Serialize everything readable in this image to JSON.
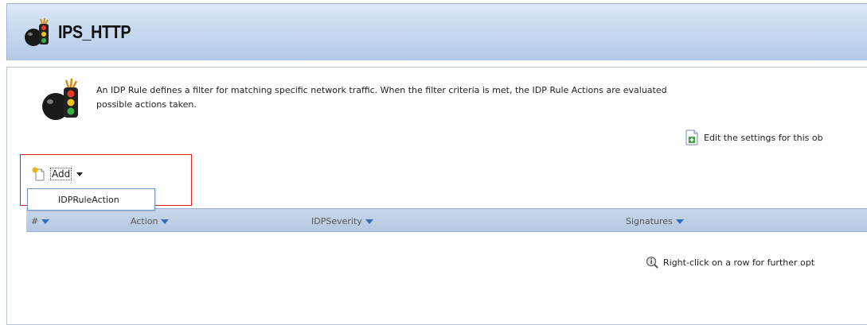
{
  "header": {
    "title": "IPS_HTTP",
    "logo_icon": "traffic-light-bomb-icon"
  },
  "description": {
    "line1": "An IDP Rule defines a filter for matching specific network traffic. When the filter criteria is met, the IDP Rule Actions are evaluated",
    "line2": "possible actions taken.",
    "icon": "traffic-light-bomb-icon"
  },
  "edit_link": {
    "label": "Edit the settings for this ob",
    "icon": "edit-add-icon"
  },
  "toolbar": {
    "add_label": "Add",
    "add_icon": "new-document-icon",
    "dropdown_items": [
      "IDPRuleAction"
    ]
  },
  "grid": {
    "columns": [
      {
        "label": "#"
      },
      {
        "label": "Action"
      },
      {
        "label": "IDPSeverity"
      },
      {
        "label": "Signatures"
      }
    ],
    "hint": "Right-click on a row for further opt",
    "hint_icon": "info-magnifier-icon"
  },
  "colors": {
    "accent": "#2f6fc0",
    "highlight_border": "#e02020",
    "header_bg": "#c4d7ee"
  }
}
